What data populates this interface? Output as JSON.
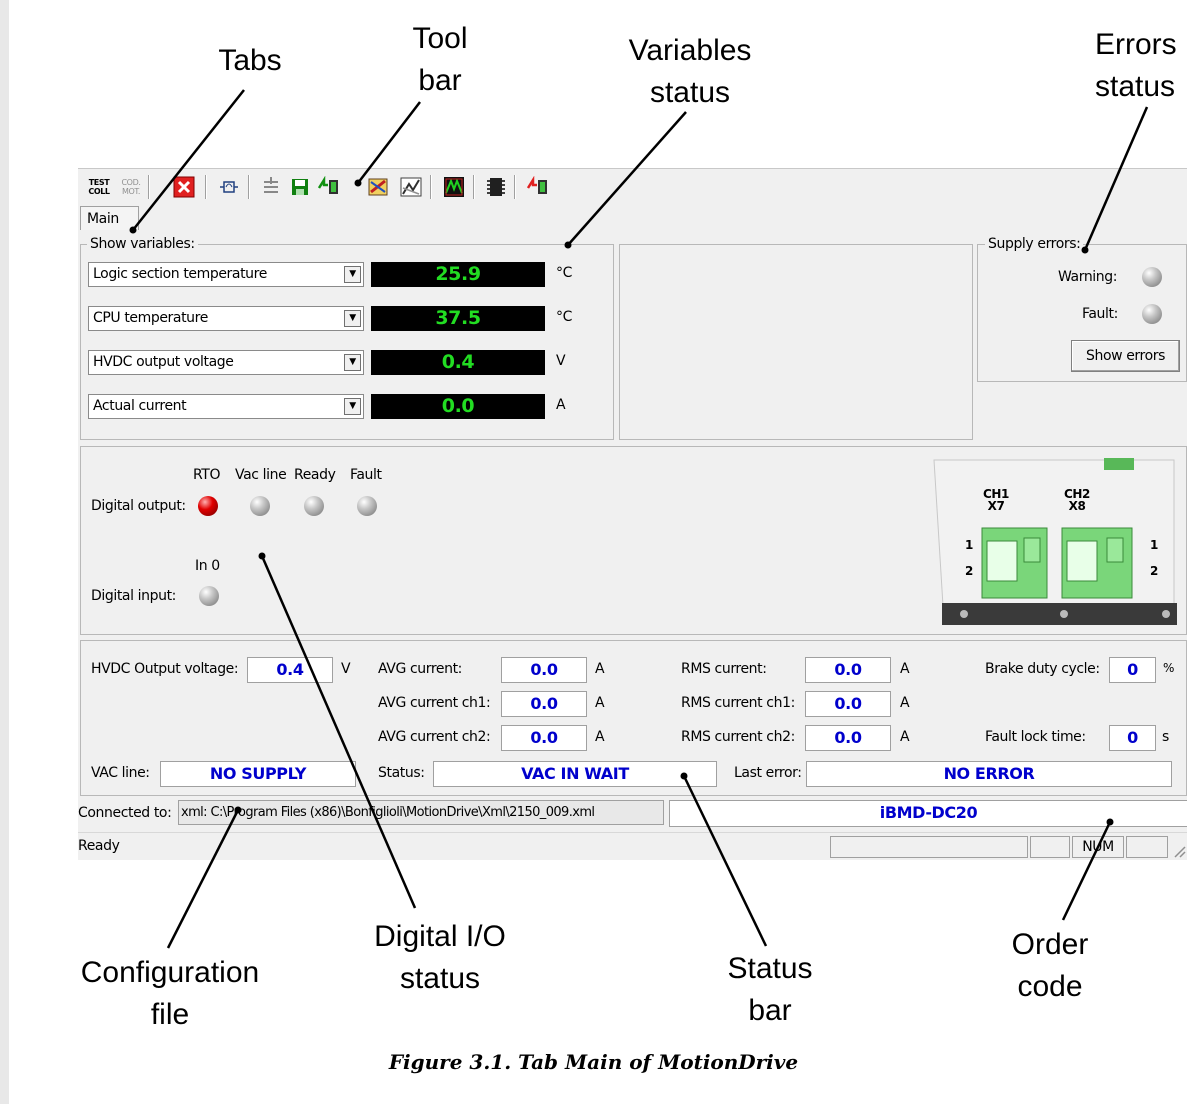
{
  "callouts": {
    "tabs": "Tabs",
    "toolbar": [
      "Tool",
      "bar"
    ],
    "variables_status": [
      "Variables",
      "status"
    ],
    "errors_status": [
      "Errors",
      "status"
    ],
    "configuration_file": [
      "Configuration",
      "file"
    ],
    "digital_io_status": [
      "Digital I/O",
      "status"
    ],
    "status_bar": [
      "Status",
      "bar"
    ],
    "order_code": [
      "Order",
      "code"
    ]
  },
  "toolbar": {
    "test_coll": [
      "TEST",
      "COLL"
    ],
    "cod_mot": [
      "COD.",
      "MOT."
    ],
    "icons": [
      "close-red-icon",
      "oscilloscope-icon",
      "download-params-icon",
      "save-icon",
      "upload-icon",
      "tools-icon",
      "chart-icon",
      "motion-icon",
      "chip-icon",
      "flash-icon"
    ]
  },
  "tabs": [
    "Main"
  ],
  "show_variables": {
    "label": "Show variables:",
    "rows": [
      {
        "name": "Logic section temperature",
        "value": "25.9",
        "unit": "°C"
      },
      {
        "name": "CPU temperature",
        "value": "37.5",
        "unit": "°C"
      },
      {
        "name": "HVDC output voltage",
        "value": "0.4",
        "unit": "V"
      },
      {
        "name": "Actual current",
        "value": "0.0",
        "unit": "A"
      }
    ]
  },
  "supply_errors": {
    "label": "Supply errors:",
    "warning": "Warning:",
    "fault": "Fault:",
    "button": "Show errors"
  },
  "digital_io": {
    "outputs_label": "Digital output:",
    "outputs": [
      {
        "name": "RTO",
        "state": "on",
        "color": "#e00000"
      },
      {
        "name": "Vac line",
        "state": "off"
      },
      {
        "name": "Ready",
        "state": "off"
      },
      {
        "name": "Fault",
        "state": "off"
      }
    ],
    "inputs_label": "Digital input:",
    "inputs": [
      {
        "name": "In 0",
        "state": "off"
      }
    ]
  },
  "connector": {
    "ch1": [
      "CH1",
      "X7"
    ],
    "ch2": [
      "CH2",
      "X8"
    ],
    "pin1": "1",
    "pin2": "2"
  },
  "measures": {
    "hvdc_label": "HVDC Output voltage:",
    "hvdc_value": "0.4",
    "hvdc_unit": "V",
    "avg_label": "AVG current:",
    "avg_value": "0.0",
    "avg_unit": "A",
    "avg_ch1_label": "AVG current ch1:",
    "avg_ch1_value": "0.0",
    "avg_ch1_unit": "A",
    "avg_ch2_label": "AVG current ch2:",
    "avg_ch2_value": "0.0",
    "avg_ch2_unit": "A",
    "rms_label": "RMS current:",
    "rms_value": "0.0",
    "rms_unit": "A",
    "rms_ch1_label": "RMS current ch1:",
    "rms_ch1_value": "0.0",
    "rms_ch1_unit": "A",
    "rms_ch2_label": "RMS current ch2:",
    "rms_ch2_value": "0.0",
    "rms_ch2_unit": "A",
    "brake_label": "Brake duty cycle:",
    "brake_value": "0",
    "brake_unit": "%",
    "fault_lock_label": "Fault lock time:",
    "fault_lock_value": "0",
    "fault_lock_unit": "s",
    "vac_label": "VAC line:",
    "vac_value": "NO SUPPLY",
    "status_label": "Status:",
    "status_value": "VAC IN WAIT",
    "last_error_label": "Last error:",
    "last_error_value": "NO ERROR"
  },
  "connection": {
    "label": "Connected to:",
    "path": "xml: C:\\Program Files (x86)\\Bonfiglioli\\MotionDrive\\Xml\\2150_009.xml",
    "order_code": "iBMD-DC20"
  },
  "statusbar": {
    "text": "Ready",
    "num": "NUM"
  },
  "caption": "Figure 3.1. Tab Main of MotionDrive",
  "colors": {
    "lcd_text": "#22dd22",
    "field_text": "#0000cc",
    "led_on": "#e00000",
    "connector_green": "#7ad67a"
  }
}
